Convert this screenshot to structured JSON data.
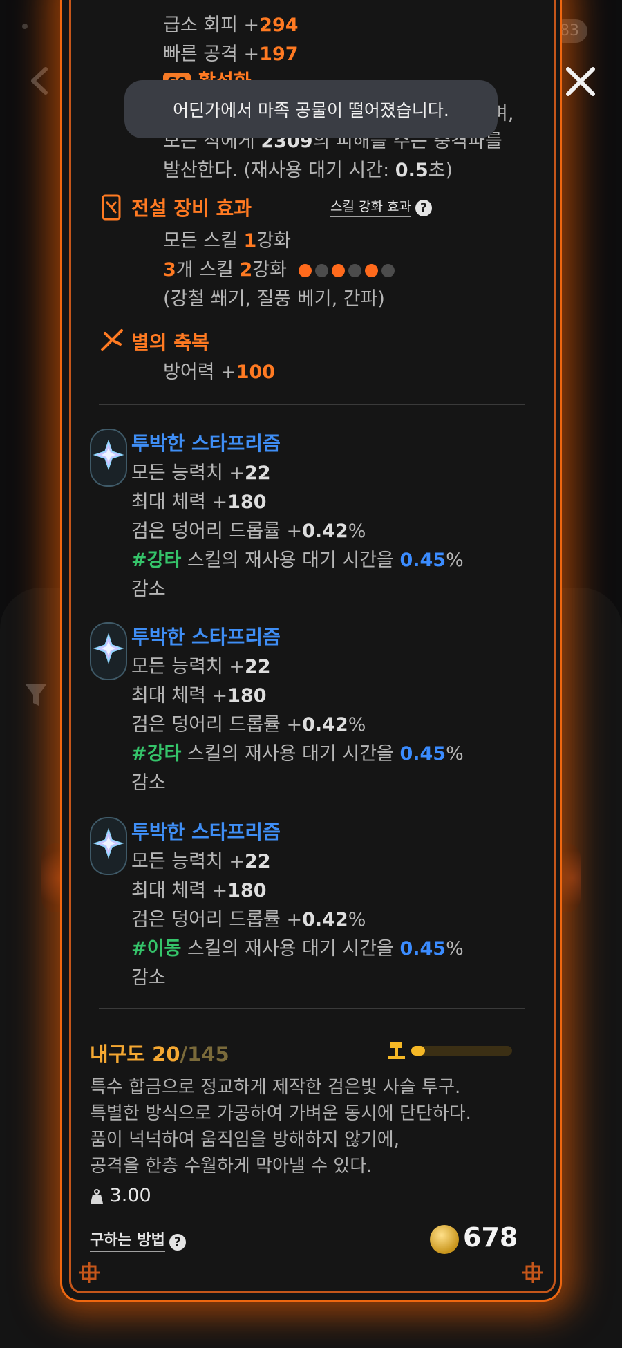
{
  "status": {
    "badge_count": "83"
  },
  "toast": {
    "message": "어딘가에서 마족 공물이 떨어졌습니다."
  },
  "top_stats": [
    {
      "label": "급소 회피 +",
      "value": "294"
    },
    {
      "label": "빠른 공격 +",
      "value": "197"
    }
  ],
  "active": {
    "badge": "S8",
    "label": "활성화"
  },
  "effect_text": {
    "line1_tail": "며,",
    "line2_pre": "모든 적에게 ",
    "line2_value": "2309",
    "line2_post": "의 피해를 주는 충격파를",
    "line3_pre": "발산한다. (재사용 대기 시간: ",
    "line3_value": "0.5",
    "line3_post": "초)"
  },
  "legendary": {
    "title": "전설 장비 효과",
    "skill_link": "스킬 강화 효과",
    "line1_pre": "모든 스킬 ",
    "line1_value": "1",
    "line1_post": "강화",
    "line2_count": "3",
    "line2_mid": "개 스킬 ",
    "line2_value": "2",
    "line2_post": "강화",
    "dots": [
      true,
      false,
      true,
      false,
      true,
      false
    ],
    "skills": "(강철 쐐기, 질풍 베기, 간파)"
  },
  "star_blessing": {
    "title": "별의 축복",
    "stat_label": "방어력 +",
    "stat_value": "100"
  },
  "gems": [
    {
      "name": "투박한 스타프리즘",
      "stat1_label": "모든 능력치 +",
      "stat1_value": "22",
      "stat2_label": "최대 체력 +",
      "stat2_value": "180",
      "stat3_label": "검은 덩어리 드롭률 +",
      "stat3_value": "0.42",
      "stat3_unit": "%",
      "tag": "#강타",
      "cd_text": " 스킬의 재사용 대기 시간을 ",
      "cd_value": "0.45",
      "cd_unit": "%",
      "cd_tail": "감소"
    },
    {
      "name": "투박한 스타프리즘",
      "stat1_label": "모든 능력치 +",
      "stat1_value": "22",
      "stat2_label": "최대 체력 +",
      "stat2_value": "180",
      "stat3_label": "검은 덩어리 드롭률 +",
      "stat3_value": "0.42",
      "stat3_unit": "%",
      "tag": "#강타",
      "cd_text": " 스킬의 재사용 대기 시간을 ",
      "cd_value": "0.45",
      "cd_unit": "%",
      "cd_tail": "감소"
    },
    {
      "name": "투박한 스타프리즘",
      "stat1_label": "모든 능력치 +",
      "stat1_value": "22",
      "stat2_label": "최대 체력 +",
      "stat2_value": "180",
      "stat3_label": "검은 덩어리 드롭률 +",
      "stat3_value": "0.42",
      "stat3_unit": "%",
      "tag": "#이동",
      "cd_text": " 스킬의 재사용 대기 시간을 ",
      "cd_value": "0.45",
      "cd_unit": "%",
      "cd_tail": "감소"
    }
  ],
  "durability": {
    "label": "내구도 ",
    "current": "20",
    "max": "/145",
    "fraction": 0.14
  },
  "description": [
    "특수 합금으로 정교하게 제작한 검은빛 사슬 투구.",
    "특별한 방식으로 가공하여 가벼운 동시에 단단하다.",
    "품이 넉넉하여 움직임을 방해하지 않기에,",
    "공격을 한층 수월하게 막아낼 수 있다."
  ],
  "weight": "3.00",
  "how_to_get": "구하는 방법",
  "price": "678",
  "colors": {
    "accent": "#ff7a22",
    "blue": "#3f8ef5",
    "green": "#35c46a",
    "gold": "#f5a832"
  },
  "icons": [
    "back-icon",
    "close-icon",
    "filter-icon",
    "rune-icon",
    "star-icon",
    "prism-gem-icon",
    "help-icon",
    "hammer-icon",
    "weight-icon",
    "coin-icon"
  ]
}
